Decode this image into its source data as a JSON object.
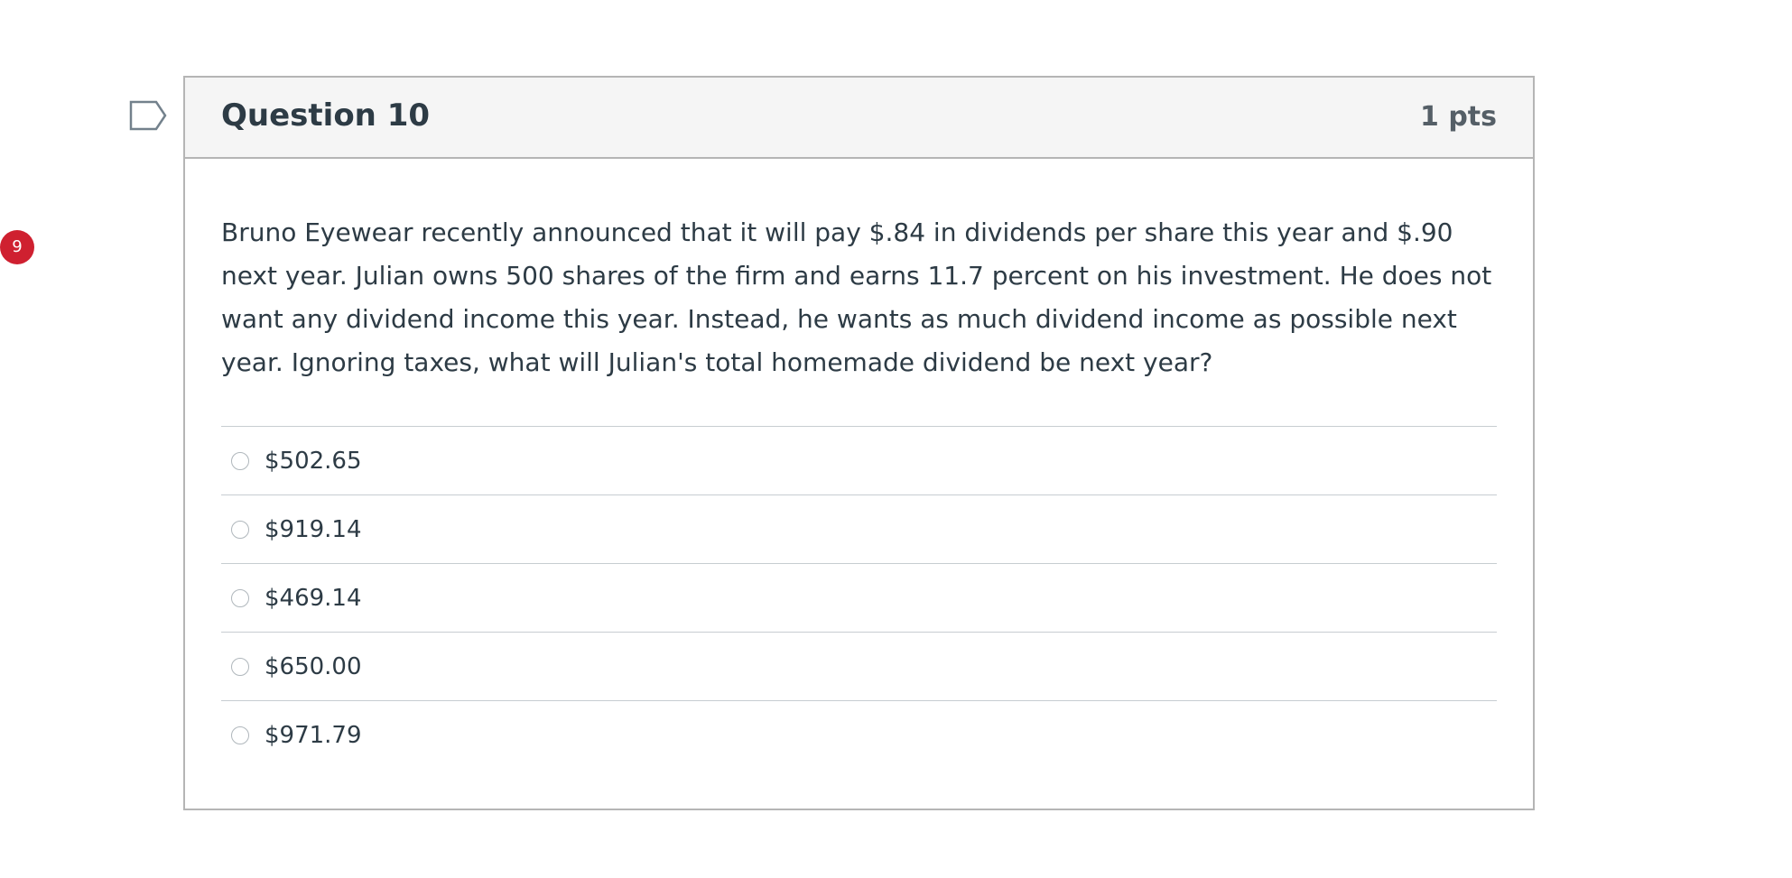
{
  "badge": {
    "count": "9"
  },
  "question": {
    "title": "Question 10",
    "points": "1 pts",
    "text": "Bruno Eyewear recently announced that it will pay $.84 in dividends per share this year and $.90 next year. Julian owns 500 shares of the firm and earns 11.7 percent on his investment. He does not want any dividend income this year. Instead, he wants as much dividend income as possible next year. Ignoring taxes, what will Julian's total homemade dividend be next year?",
    "answers": [
      {
        "label": "$502.65",
        "selected": false
      },
      {
        "label": "$919.14",
        "selected": false
      },
      {
        "label": "$469.14",
        "selected": false
      },
      {
        "label": "$650.00",
        "selected": false
      },
      {
        "label": "$971.79",
        "selected": false
      }
    ]
  },
  "icons": {
    "flag": "flag-outline-icon"
  },
  "colors": {
    "badge": "#cf2030",
    "header_bg": "#f5f5f5",
    "border": "#b5b5b5",
    "text": "#2d3b45",
    "flag_stroke": "#73818c"
  }
}
